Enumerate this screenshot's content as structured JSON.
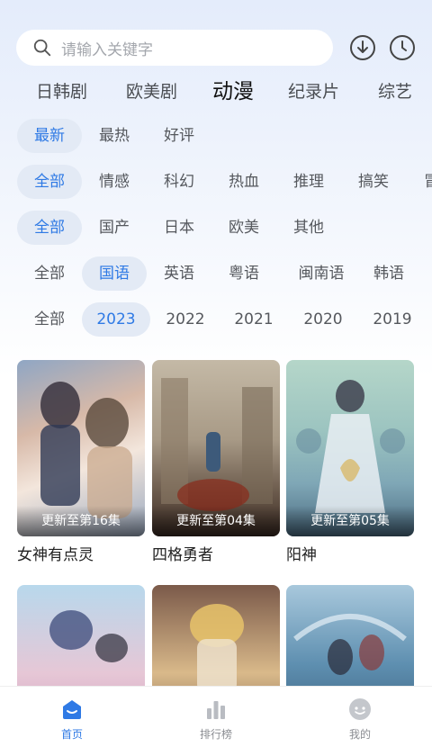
{
  "search": {
    "placeholder": "请输入关键字"
  },
  "categories": [
    {
      "label": "日韩剧"
    },
    {
      "label": "欧美剧"
    },
    {
      "label": "动漫",
      "active": true
    },
    {
      "label": "纪录片"
    },
    {
      "label": "综艺"
    }
  ],
  "filters": {
    "sort": [
      "最新",
      "最热",
      "好评"
    ],
    "genre": [
      "全部",
      "情感",
      "科幻",
      "热血",
      "推理",
      "搞笑",
      "冒"
    ],
    "region": [
      "全部",
      "国产",
      "日本",
      "欧美",
      "其他"
    ],
    "language": [
      "全部",
      "国语",
      "英语",
      "粤语",
      "闽南语",
      "韩语"
    ],
    "year": [
      "全部",
      "2023",
      "2022",
      "2021",
      "2020",
      "2019"
    ]
  },
  "cards": [
    {
      "title": "女神有点灵",
      "episode": "更新至第16集"
    },
    {
      "title": "四格勇者",
      "episode": "更新至第04集"
    },
    {
      "title": "阳神",
      "episode": "更新至第05集"
    },
    {
      "title": "",
      "episode": ""
    },
    {
      "title": "",
      "episode": ""
    },
    {
      "title": "",
      "episode": ""
    }
  ],
  "bottom_nav": [
    {
      "label": "首页",
      "icon": "home-icon",
      "active": true
    },
    {
      "label": "排行榜",
      "icon": "ranking-icon"
    },
    {
      "label": "我的",
      "icon": "profile-icon"
    }
  ],
  "colors": {
    "accent": "#2f7ae5",
    "chip_bg": "#e3eaf5"
  }
}
